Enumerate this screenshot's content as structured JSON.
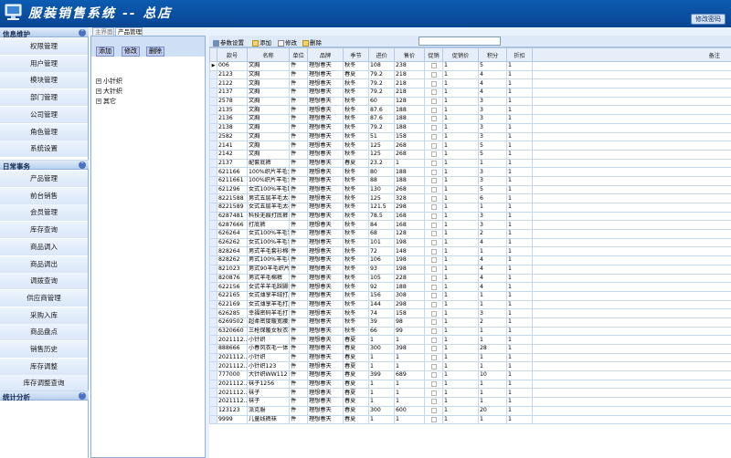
{
  "header": {
    "title": "服装销售系统 -- 总店",
    "change_password": "修改密码"
  },
  "sidebar": {
    "groups": [
      {
        "title": "信息维护",
        "items": [
          "权限管理",
          "用户管理",
          "模块管理",
          "部门管理",
          "公司管理",
          "角色管理",
          "系统设置"
        ]
      },
      {
        "title": "日常事务",
        "items": [
          "产品管理",
          "前台销售",
          "会员管理",
          "库存查询",
          "商品调入",
          "商品调出",
          "调拨查询",
          "供应商管理",
          "采购入库",
          "商品盘点",
          "销售历史",
          "库存调整",
          "库存调整查询"
        ]
      },
      {
        "title": "统计分析",
        "items": []
      }
    ]
  },
  "tabs": [
    "主界面",
    "产品管理"
  ],
  "left_panel": {
    "buttons": [
      "添加",
      "修改",
      "删除"
    ],
    "tree": [
      "小针织",
      "大针织",
      "其它"
    ]
  },
  "toolbar": {
    "param_settings": "参数设置",
    "add": "添加",
    "edit": "修改",
    "delete": "删除",
    "search_value": ""
  },
  "grid": {
    "columns": [
      "款号",
      "名称",
      "单位",
      "品牌",
      "季节",
      "进价",
      "售价",
      "促销",
      "促销价",
      "积分",
      "折扣",
      "备注"
    ],
    "rows": [
      [
        "006",
        "文胸",
        "件",
        "理想春天",
        "秋冬",
        "108",
        "238",
        "",
        "1",
        "5",
        "1",
        ""
      ],
      [
        "2123",
        "文胸",
        "件",
        "理想春天",
        "春夏",
        "79.2",
        "218",
        "",
        "1",
        "4",
        "1",
        ""
      ],
      [
        "2122",
        "文胸",
        "件",
        "理想春天",
        "秋冬",
        "79.2",
        "218",
        "",
        "1",
        "4",
        "1",
        ""
      ],
      [
        "2137",
        "文胸",
        "件",
        "理想春天",
        "秋冬",
        "79.2",
        "218",
        "",
        "1",
        "4",
        "1",
        ""
      ],
      [
        "2578",
        "文胸",
        "件",
        "理想春天",
        "秋冬",
        "60",
        "128",
        "",
        "1",
        "3",
        "1",
        ""
      ],
      [
        "2135",
        "文胸",
        "件",
        "理想春天",
        "秋冬",
        "87.6",
        "188",
        "",
        "1",
        "3",
        "1",
        ""
      ],
      [
        "2136",
        "文胸",
        "件",
        "理想春天",
        "秋冬",
        "87.6",
        "188",
        "",
        "1",
        "3",
        "1",
        ""
      ],
      [
        "2138",
        "文胸",
        "件",
        "理想春天",
        "秋冬",
        "79.2",
        "188",
        "",
        "1",
        "3",
        "1",
        ""
      ],
      [
        "2582",
        "文胸",
        "件",
        "理想春天",
        "秋冬",
        "51",
        "158",
        "",
        "1",
        "3",
        "1",
        ""
      ],
      [
        "2141",
        "文胸",
        "件",
        "理想春天",
        "秋冬",
        "125",
        "268",
        "",
        "1",
        "5",
        "1",
        ""
      ],
      [
        "2142",
        "文胸",
        "件",
        "理想春天",
        "秋冬",
        "125",
        "268",
        "",
        "1",
        "5",
        "1",
        ""
      ],
      [
        "2137",
        "配套底裤",
        "件",
        "理想春天",
        "春夏",
        "23.2",
        "1",
        "",
        "1",
        "1",
        "1",
        ""
      ],
      [
        "621166",
        "100%织片羊毛女...",
        "件",
        "理想春天",
        "秋冬",
        "80",
        "188",
        "",
        "1",
        "3",
        "1",
        ""
      ],
      [
        "6211661",
        "100%织片羊毛女...",
        "件",
        "理想春天",
        "秋冬",
        "88",
        "188",
        "",
        "1",
        "3",
        "1",
        ""
      ],
      [
        "621296",
        "女式100%羊毛匹...",
        "件",
        "理想春天",
        "秋冬",
        "130",
        "268",
        "",
        "1",
        "5",
        "1",
        ""
      ],
      [
        "8221588",
        "男式五层羊毛太极...",
        "件",
        "理想春天",
        "秋冬",
        "125",
        "328",
        "",
        "1",
        "6",
        "1",
        ""
      ],
      [
        "8221589",
        "女式五层羊毛太极...",
        "件",
        "理想春天",
        "秋冬",
        "121.5",
        "298",
        "",
        "1",
        "1",
        "1",
        ""
      ],
      [
        "6287481",
        "科技无痕打底裤",
        "件",
        "理想春天",
        "秋冬",
        "78.5",
        "168",
        "",
        "1",
        "3",
        "1",
        ""
      ],
      [
        "6287666",
        "打底裤",
        "件",
        "理想春天",
        "秋冬",
        "84",
        "168",
        "",
        "1",
        "3",
        "1",
        ""
      ],
      [
        "626264",
        "女式100%羊毛套...",
        "件",
        "理想春天",
        "秋冬",
        "68",
        "128",
        "",
        "1",
        "2",
        "1",
        ""
      ],
      [
        "626262",
        "女式100%羊毛套...",
        "件",
        "理想春天",
        "秋冬",
        "101",
        "198",
        "",
        "1",
        "4",
        "1",
        ""
      ],
      [
        "828264",
        "男式羊毛套衫棉裤",
        "件",
        "理想春天",
        "秋冬",
        "72",
        "148",
        "",
        "1",
        "1",
        "1",
        ""
      ],
      [
        "828262",
        "男式100%羊毛毛...",
        "件",
        "理想春天",
        "秋冬",
        "106",
        "198",
        "",
        "1",
        "4",
        "1",
        ""
      ],
      [
        "821023",
        "男式90羊毛织片加...",
        "件",
        "理想春天",
        "秋冬",
        "93",
        "198",
        "",
        "1",
        "4",
        "1",
        ""
      ],
      [
        "820876",
        "男式羊毛棉裤",
        "件",
        "理想春天",
        "秋冬",
        "105",
        "228",
        "",
        "1",
        "4",
        "1",
        ""
      ],
      [
        "622156",
        "女式羊羊毛踩脚打...",
        "件",
        "理想春天",
        "秋冬",
        "92",
        "188",
        "",
        "1",
        "4",
        "1",
        ""
      ],
      [
        "622165",
        "女式薄享羊绒打底裤",
        "件",
        "理想春天",
        "秋冬",
        "156",
        "308",
        "",
        "1",
        "1",
        "1",
        ""
      ],
      [
        "622169",
        "女式薄享羊毛打底裤",
        "件",
        "理想春天",
        "秋冬",
        "144",
        "298",
        "",
        "1",
        "1",
        "1",
        ""
      ],
      [
        "626285",
        "幸福密码羊毛打...",
        "件",
        "理想春天",
        "秋冬",
        "74",
        "158",
        "",
        "1",
        "3",
        "1",
        ""
      ],
      [
        "6269502",
        "超柔密度暖宽腰连...",
        "件",
        "理想春天",
        "秋冬",
        "39",
        "98",
        "",
        "1",
        "2",
        "1",
        ""
      ],
      [
        "6320660",
        "三枪保暖女秋衣裤...",
        "件",
        "理想春天",
        "秋冬",
        "66",
        "99",
        "",
        "1",
        "1",
        "1",
        ""
      ],
      [
        "2021112...",
        "小针织",
        "件",
        "理想春天",
        "春夏",
        "1",
        "1",
        "",
        "1",
        "1",
        "1",
        ""
      ],
      [
        "888666",
        "小春风衣毛一体",
        "件",
        "理想春天",
        "春夏",
        "300",
        "398",
        "",
        "1",
        "28",
        "1",
        ""
      ],
      [
        "2021112...",
        "小针织",
        "件",
        "理想春天",
        "春夏",
        "1",
        "1",
        "",
        "1",
        "1",
        "1",
        ""
      ],
      [
        "2021112...",
        "小针织123",
        "件",
        "理想春天",
        "春夏",
        "1",
        "1",
        "",
        "1",
        "1",
        "1",
        ""
      ],
      [
        "777000",
        "大针织WW112",
        "件",
        "理想春天",
        "春夏",
        "399",
        "689",
        "",
        "1",
        "10",
        "1",
        ""
      ],
      [
        "2021112...",
        "袜子1256",
        "件",
        "理想春天",
        "春夏",
        "1",
        "1",
        "",
        "1",
        "1",
        "1",
        ""
      ],
      [
        "2021112...",
        "袜子",
        "件",
        "理想春天",
        "春夏",
        "1",
        "1",
        "",
        "1",
        "1",
        "1",
        ""
      ],
      [
        "2021112...",
        "袜子",
        "件",
        "理想春天",
        "春夏",
        "1",
        "1",
        "",
        "1",
        "1",
        "1",
        ""
      ],
      [
        "123123",
        "派克服",
        "件",
        "理想春天",
        "春夏",
        "300",
        "600",
        "",
        "1",
        "20",
        "1",
        ""
      ],
      [
        "9999",
        "儿童线裤袜",
        "件",
        "理想春天",
        "春夏",
        "1",
        "1",
        "",
        "1",
        "1",
        "1",
        ""
      ]
    ]
  }
}
